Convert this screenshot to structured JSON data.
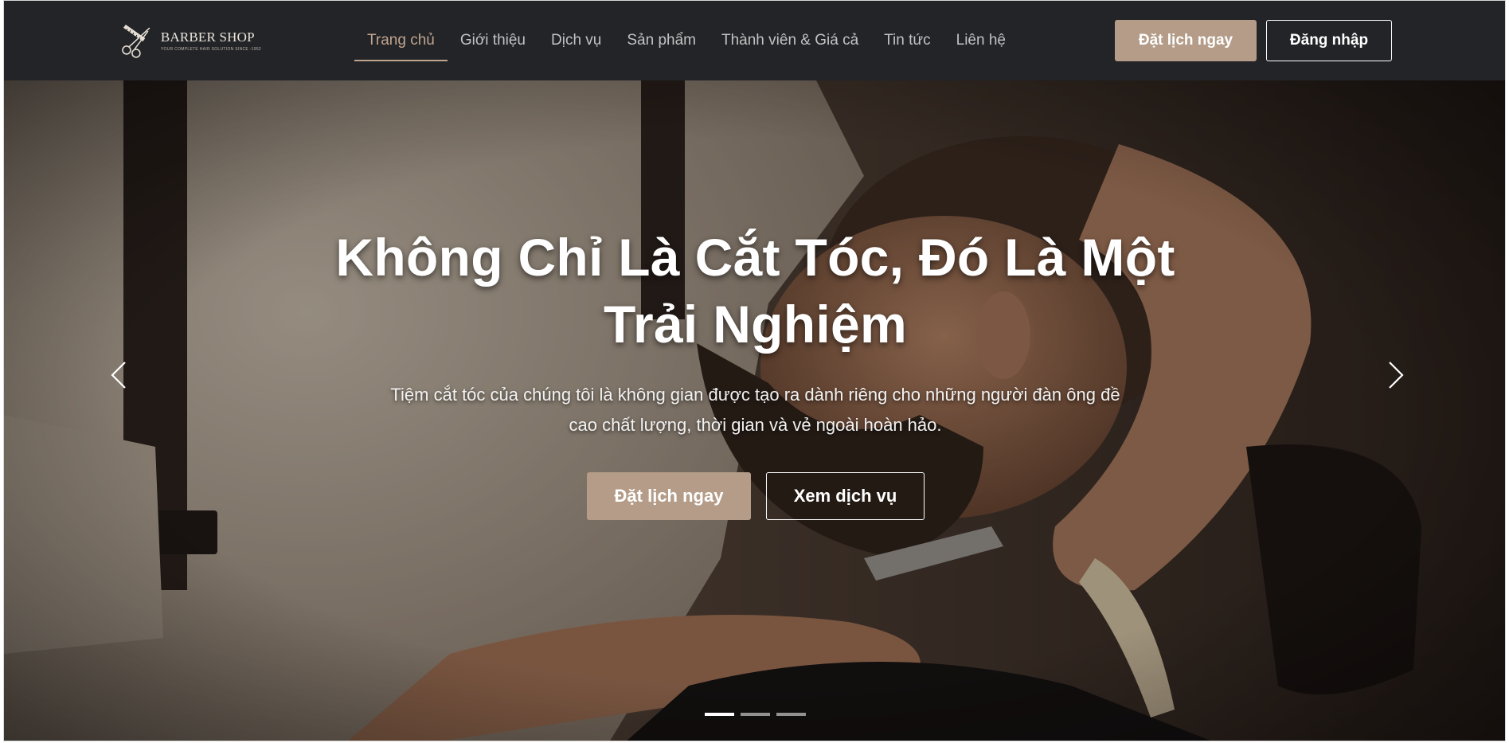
{
  "brand": {
    "name": "BARBER SHOP",
    "tagline": "YOUR COMPLETE HAIR SOLUTION SINCE -1952",
    "logo_icon": "scissors-comb-icon"
  },
  "nav": {
    "items": [
      {
        "label": "Trang chủ",
        "active": true
      },
      {
        "label": "Giới thiệu"
      },
      {
        "label": "Dịch vụ"
      },
      {
        "label": "Sản phẩm"
      },
      {
        "label": "Thành viên & Giá cả"
      },
      {
        "label": "Tin tức"
      },
      {
        "label": "Liên hệ"
      }
    ]
  },
  "header": {
    "book_label": "Đặt lịch ngay",
    "login_label": "Đăng nhập"
  },
  "hero": {
    "title_line1": "Không Chỉ Là Cắt Tóc, Đó Là Một",
    "title_line2": "Trải Nghiệm",
    "subtitle_line1": "Tiệm cắt tóc của chúng tôi là không gian được tạo ra dành riêng cho những người đàn ông đề",
    "subtitle_line2": "cao chất lượng, thời gian và vẻ ngoài hoàn hảo.",
    "primary_label": "Đặt lịch ngay",
    "secondary_label": "Xem dịch vụ",
    "slide_count": 3,
    "active_slide": 1
  },
  "colors": {
    "header_bg": "#222428",
    "accent": "#b49c88",
    "nav_active": "#c0a48e",
    "nav_text": "#c2c2c2"
  }
}
